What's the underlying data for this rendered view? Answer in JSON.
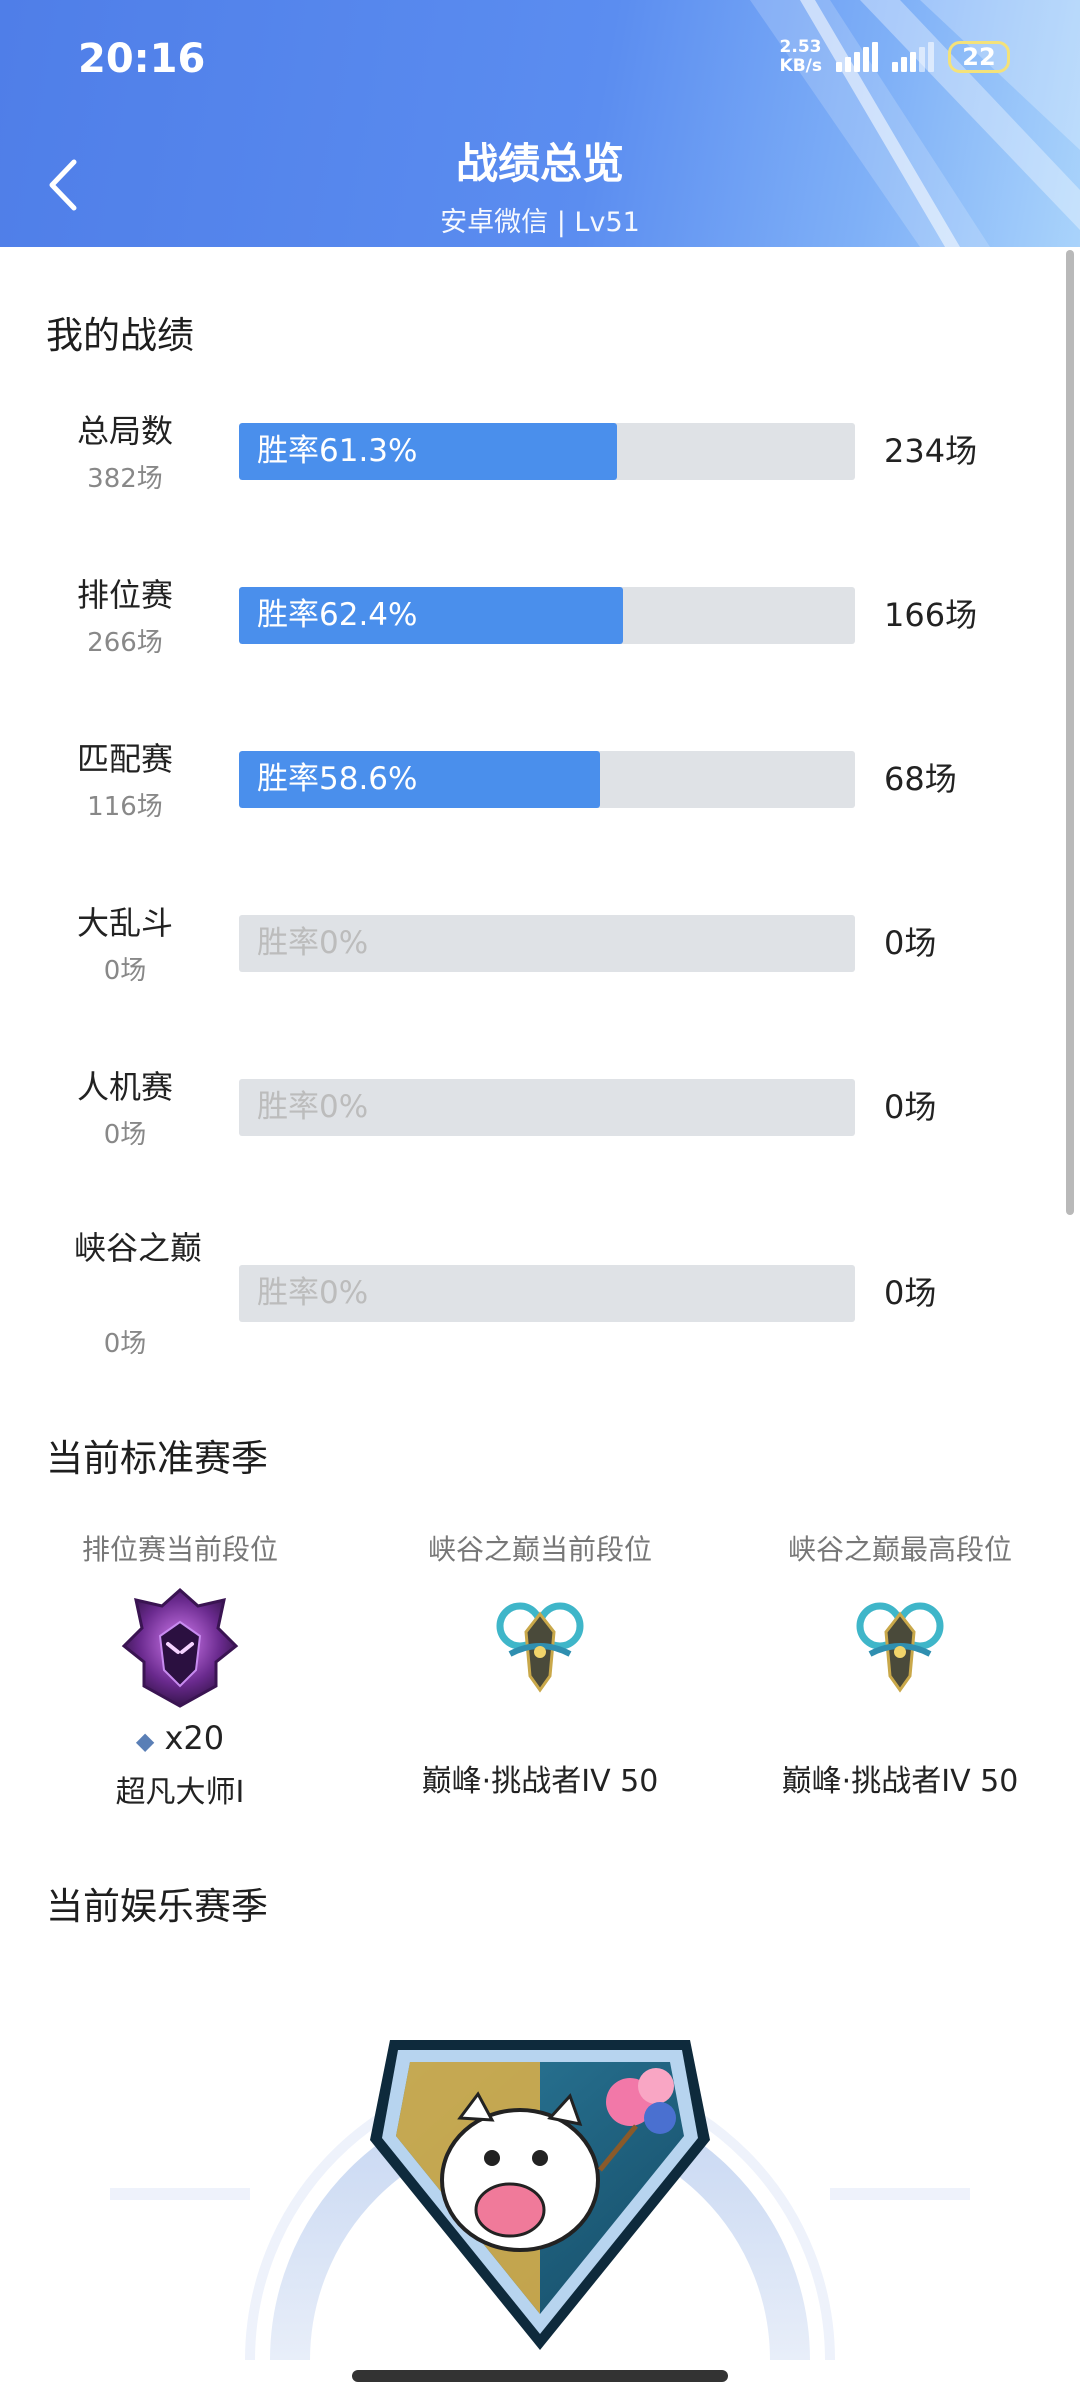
{
  "status_bar": {
    "time": "20:16",
    "net_speed_value": "2.53",
    "net_speed_unit": "KB/s",
    "sig1": "5G",
    "sig2": "5GA",
    "battery": "22"
  },
  "header": {
    "title": "战绩总览",
    "subtitle": "安卓微信 | Lv51"
  },
  "my_record": {
    "title": "我的战绩",
    "rows": [
      {
        "name": "总局数",
        "count": "382场",
        "winrate_label": "胜率61.3%",
        "winrate": 0.613,
        "wins": "234场"
      },
      {
        "name": "排位赛",
        "count": "266场",
        "winrate_label": "胜率62.4%",
        "winrate": 0.624,
        "wins": "166场"
      },
      {
        "name": "匹配赛",
        "count": "116场",
        "winrate_label": "胜率58.6%",
        "winrate": 0.586,
        "wins": "68场"
      },
      {
        "name": "大乱斗",
        "count": "0场",
        "winrate_label": "胜率0%",
        "winrate": 0,
        "wins": "0场"
      },
      {
        "name": "人机赛",
        "count": "0场",
        "winrate_label": "胜率0%",
        "winrate": 0,
        "wins": "0场"
      },
      {
        "name": "峡谷之巅",
        "count": "0场",
        "winrate_label": "胜率0%",
        "winrate": 0,
        "wins": "0场"
      }
    ]
  },
  "standard_season": {
    "title": "当前标准赛季",
    "ranks": [
      {
        "label": "排位赛当前段位",
        "emblem": "master-emblem",
        "stars": "x20",
        "name": "超凡大师I"
      },
      {
        "label": "峡谷之巅当前段位",
        "emblem": "peak-emblem",
        "name": "巅峰·挑战者IV 50"
      },
      {
        "label": "峡谷之巅最高段位",
        "emblem": "peak-emblem",
        "name": "巅峰·挑战者IV 50"
      }
    ]
  },
  "fun_season": {
    "title": "当前娱乐赛季",
    "emblem": "poro-badge"
  },
  "colors": {
    "accent": "#4a8fec",
    "track": "#dfe2e6",
    "header": "#5b8df0"
  }
}
